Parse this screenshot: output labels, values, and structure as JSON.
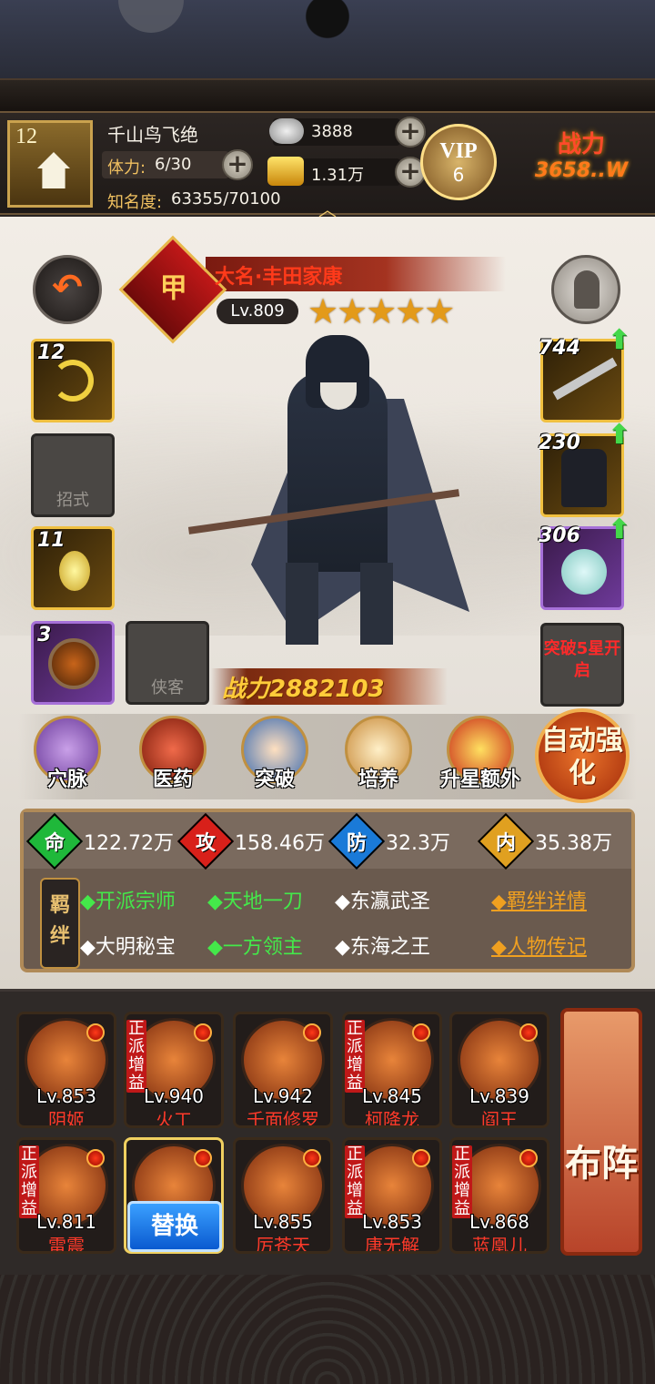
{
  "header": {
    "player_level": "12",
    "player_name": "千山鸟飞绝",
    "stamina_label": "体力:",
    "stamina_value": "6/30",
    "fame_label": "知名度:",
    "fame_value": "63355/70100",
    "silver": "3888",
    "gold": "1.31万",
    "vip_label": "VIP",
    "vip_level": "6",
    "power_label": "战力",
    "power_value": "3658..W"
  },
  "hero": {
    "rank_char": "甲",
    "name": "大名·丰田家康",
    "level": "Lv.809",
    "stars": "★★★★★",
    "star_count": 5,
    "combat_power": "战力2882103"
  },
  "left_slots": [
    {
      "num": "12",
      "label": ""
    },
    {
      "num": "",
      "label": "招式"
    },
    {
      "num": "11",
      "label": ""
    },
    {
      "num": "3",
      "label": ""
    }
  ],
  "extra_slot": {
    "label": "侠客"
  },
  "right_slots": [
    {
      "num": "744"
    },
    {
      "num": "230"
    },
    {
      "num": "306"
    }
  ],
  "break_text": "突破5星开启",
  "functions": [
    {
      "label": "穴脉"
    },
    {
      "label": "医药"
    },
    {
      "label": "突破"
    },
    {
      "label": "培养"
    },
    {
      "label": "升星额外"
    }
  ],
  "auto_label": "自动强化",
  "attributes": [
    {
      "char": "命",
      "value": "122.72万",
      "color": "#1fb83a"
    },
    {
      "char": "攻",
      "value": "158.46万",
      "color": "#d8201a"
    },
    {
      "char": "防",
      "value": "32.3万",
      "color": "#1a7ad8"
    },
    {
      "char": "内",
      "value": "35.38万",
      "color": "#e0a020"
    }
  ],
  "bond_label": "羁绊",
  "bonds": [
    {
      "text": "◆开派宗师",
      "active": true
    },
    {
      "text": "◆天地一刀",
      "active": true
    },
    {
      "text": "◆东瀛武圣",
      "active": false
    },
    {
      "text": "◆大明秘宝",
      "active": false
    },
    {
      "text": "◆一方领主",
      "active": true
    },
    {
      "text": "◆东海之王",
      "active": false
    }
  ],
  "links": {
    "bond_detail": "◆羁绊详情",
    "biography": "◆人物传记"
  },
  "roster": [
    {
      "level": "Lv.853",
      "name": "阴姬",
      "tag": ""
    },
    {
      "level": "Lv.940",
      "name": "火工",
      "tag": "正派增益"
    },
    {
      "level": "Lv.942",
      "name": "千面修罗",
      "tag": ""
    },
    {
      "level": "Lv.845",
      "name": "柯降龙",
      "tag": "正派增益"
    },
    {
      "level": "Lv.839",
      "name": "阎王",
      "tag": ""
    },
    {
      "level": "Lv.811",
      "name": "雷震",
      "tag": "正派增益"
    },
    {
      "level": "",
      "name": "",
      "tag": ""
    },
    {
      "level": "Lv.855",
      "name": "厉苍天",
      "tag": ""
    },
    {
      "level": "Lv.853",
      "name": "唐无解",
      "tag": "正派增益"
    },
    {
      "level": "Lv.868",
      "name": "蓝凰儿",
      "tag": "正派增益"
    }
  ],
  "swap_label": "替换",
  "formation_label": "布阵"
}
